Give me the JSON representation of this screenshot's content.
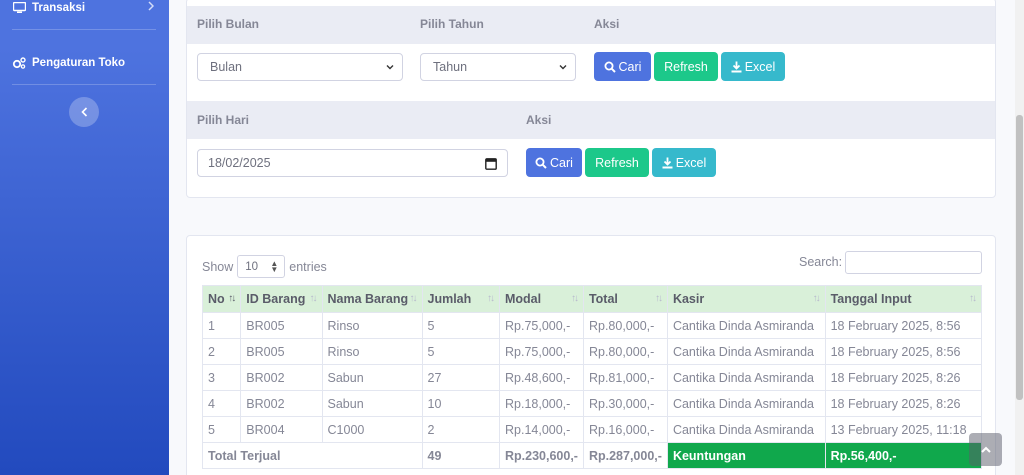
{
  "sidebar": {
    "items": [
      {
        "label": "Transaksi",
        "icon": "monitor-icon"
      },
      {
        "label": "Pengaturan Toko",
        "icon": "cogs-icon"
      }
    ]
  },
  "filter_month": {
    "month_label": "Pilih Bulan",
    "year_label": "Pilih Tahun",
    "action_label": "Aksi",
    "month_value": "Bulan",
    "year_value": "Tahun",
    "search_button": "Cari",
    "refresh_button": "Refresh",
    "excel_button": "Excel"
  },
  "filter_day": {
    "day_label": "Pilih Hari",
    "action_label": "Aksi",
    "date_value": "18/02/2025",
    "search_button": "Cari",
    "refresh_button": "Refresh",
    "excel_button": "Excel"
  },
  "datatable": {
    "show_label": "Show",
    "entries_value": "10",
    "entries_label": "entries",
    "search_label": "Search:",
    "columns": [
      "No",
      "ID Barang",
      "Nama Barang",
      "Jumlah",
      "Modal",
      "Total",
      "Kasir",
      "Tanggal Input"
    ],
    "rows": [
      [
        "1",
        "BR005",
        "Rinso",
        "5",
        "Rp.75,000,-",
        "Rp.80,000,-",
        "Cantika Dinda Asmiranda",
        "18 February 2025, 8:56"
      ],
      [
        "2",
        "BR005",
        "Rinso",
        "5",
        "Rp.75,000,-",
        "Rp.80,000,-",
        "Cantika Dinda Asmiranda",
        "18 February 2025, 8:56"
      ],
      [
        "3",
        "BR002",
        "Sabun",
        "27",
        "Rp.48,600,-",
        "Rp.81,000,-",
        "Cantika Dinda Asmiranda",
        "18 February 2025, 8:26"
      ],
      [
        "4",
        "BR002",
        "Sabun",
        "10",
        "Rp.18,000,-",
        "Rp.30,000,-",
        "Cantika Dinda Asmiranda",
        "18 February 2025, 8:26"
      ],
      [
        "5",
        "BR004",
        "C1000",
        "2",
        "Rp.14,000,-",
        "Rp.16,000,-",
        "Cantika Dinda Asmiranda",
        "13 February 2025, 11:18"
      ]
    ],
    "footer": {
      "label": "Total Terjual",
      "jumlah": "49",
      "modal": "Rp.230,600,-",
      "total": "Rp.287,000,-",
      "profit_label": "Keuntungan",
      "profit_value": "Rp.56,400,-"
    }
  },
  "colors": {
    "primary": "#4e73df",
    "success": "#1cc88a",
    "info": "#36b9cc",
    "header_green": "#d9f0d9",
    "profit_green": "#10a84c"
  }
}
